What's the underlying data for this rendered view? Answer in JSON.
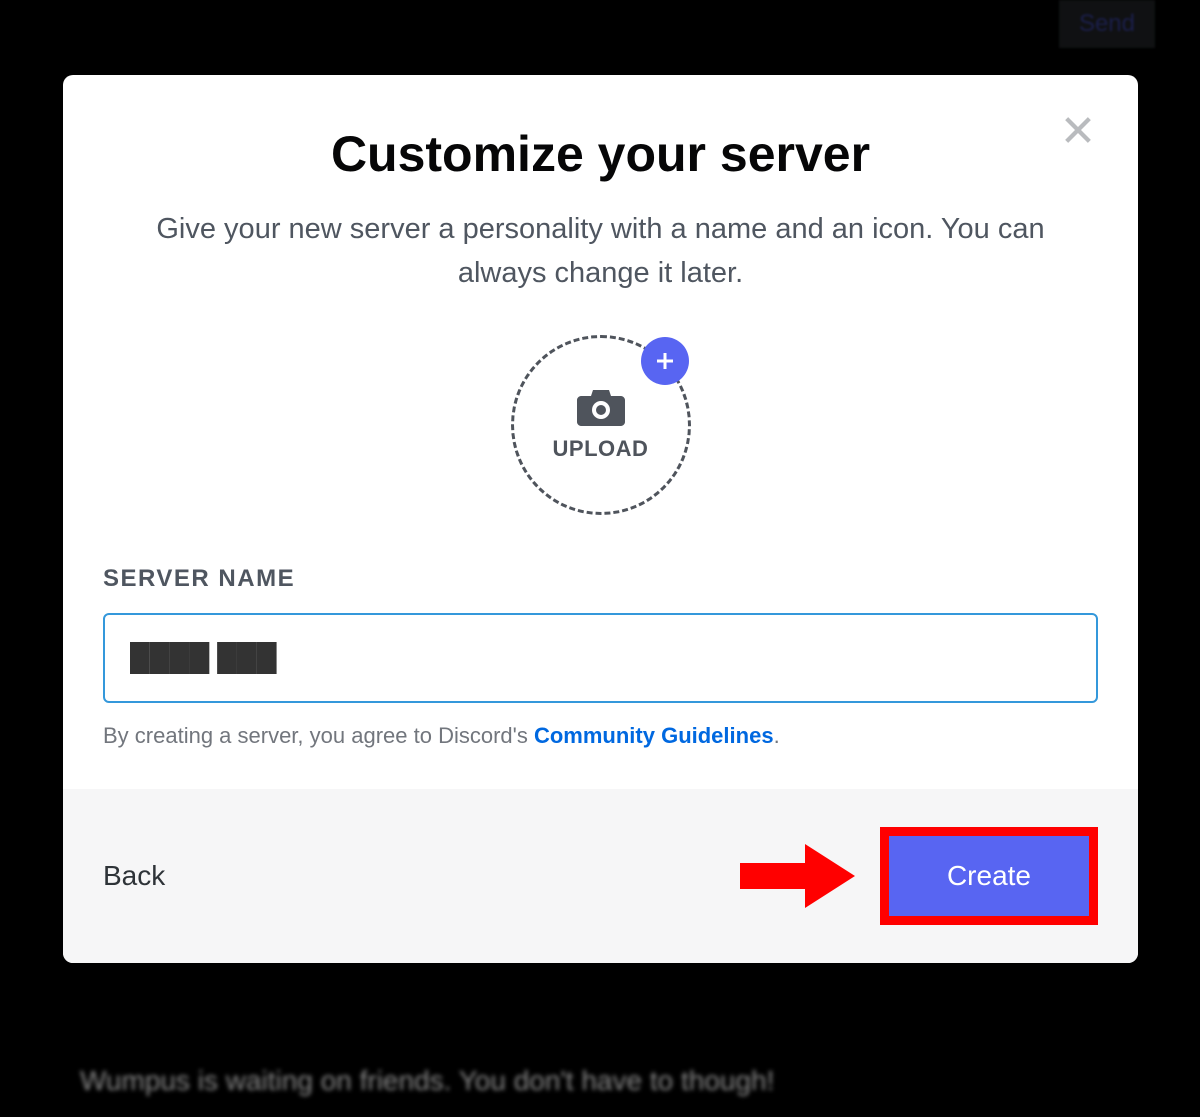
{
  "background": {
    "wumpus_text": "Wumpus is waiting on friends. You don't have to though!",
    "send_label": "Send"
  },
  "modal": {
    "title": "Customize your server",
    "subtitle": "Give your new server a personality with a name and an icon. You can always change it later.",
    "upload": {
      "label": "UPLOAD"
    },
    "field_label": "SERVER NAME",
    "server_name_value": "████ ███",
    "disclaimer_prefix": "By creating a server, you agree to Discord's ",
    "disclaimer_link": "Community Guidelines",
    "disclaimer_suffix": ".",
    "footer": {
      "back_label": "Back",
      "create_label": "Create"
    }
  },
  "colors": {
    "accent": "#5865f2",
    "highlight": "#ff0000",
    "input_border": "#3498db"
  }
}
